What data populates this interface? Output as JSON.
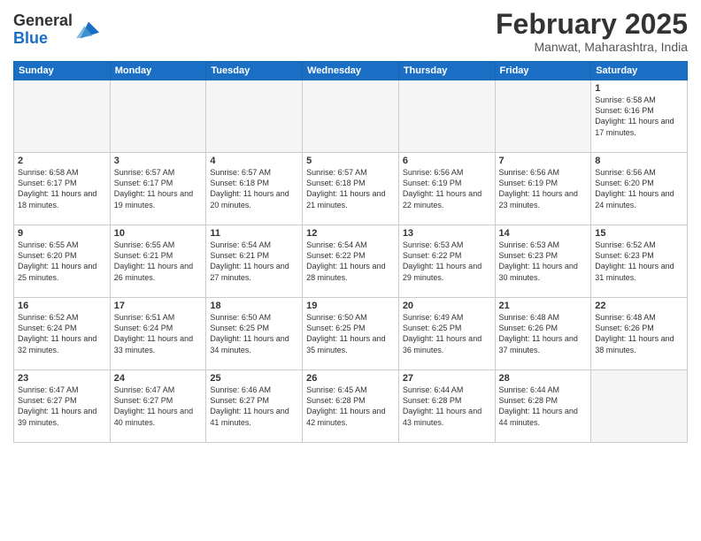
{
  "header": {
    "logo_general": "General",
    "logo_blue": "Blue",
    "title": "February 2025",
    "location": "Manwat, Maharashtra, India"
  },
  "calendar": {
    "days_of_week": [
      "Sunday",
      "Monday",
      "Tuesday",
      "Wednesday",
      "Thursday",
      "Friday",
      "Saturday"
    ],
    "weeks": [
      [
        {
          "day": "",
          "info": ""
        },
        {
          "day": "",
          "info": ""
        },
        {
          "day": "",
          "info": ""
        },
        {
          "day": "",
          "info": ""
        },
        {
          "day": "",
          "info": ""
        },
        {
          "day": "",
          "info": ""
        },
        {
          "day": "1",
          "info": "Sunrise: 6:58 AM\nSunset: 6:16 PM\nDaylight: 11 hours and 17 minutes."
        }
      ],
      [
        {
          "day": "2",
          "info": "Sunrise: 6:58 AM\nSunset: 6:17 PM\nDaylight: 11 hours and 18 minutes."
        },
        {
          "day": "3",
          "info": "Sunrise: 6:57 AM\nSunset: 6:17 PM\nDaylight: 11 hours and 19 minutes."
        },
        {
          "day": "4",
          "info": "Sunrise: 6:57 AM\nSunset: 6:18 PM\nDaylight: 11 hours and 20 minutes."
        },
        {
          "day": "5",
          "info": "Sunrise: 6:57 AM\nSunset: 6:18 PM\nDaylight: 11 hours and 21 minutes."
        },
        {
          "day": "6",
          "info": "Sunrise: 6:56 AM\nSunset: 6:19 PM\nDaylight: 11 hours and 22 minutes."
        },
        {
          "day": "7",
          "info": "Sunrise: 6:56 AM\nSunset: 6:19 PM\nDaylight: 11 hours and 23 minutes."
        },
        {
          "day": "8",
          "info": "Sunrise: 6:56 AM\nSunset: 6:20 PM\nDaylight: 11 hours and 24 minutes."
        }
      ],
      [
        {
          "day": "9",
          "info": "Sunrise: 6:55 AM\nSunset: 6:20 PM\nDaylight: 11 hours and 25 minutes."
        },
        {
          "day": "10",
          "info": "Sunrise: 6:55 AM\nSunset: 6:21 PM\nDaylight: 11 hours and 26 minutes."
        },
        {
          "day": "11",
          "info": "Sunrise: 6:54 AM\nSunset: 6:21 PM\nDaylight: 11 hours and 27 minutes."
        },
        {
          "day": "12",
          "info": "Sunrise: 6:54 AM\nSunset: 6:22 PM\nDaylight: 11 hours and 28 minutes."
        },
        {
          "day": "13",
          "info": "Sunrise: 6:53 AM\nSunset: 6:22 PM\nDaylight: 11 hours and 29 minutes."
        },
        {
          "day": "14",
          "info": "Sunrise: 6:53 AM\nSunset: 6:23 PM\nDaylight: 11 hours and 30 minutes."
        },
        {
          "day": "15",
          "info": "Sunrise: 6:52 AM\nSunset: 6:23 PM\nDaylight: 11 hours and 31 minutes."
        }
      ],
      [
        {
          "day": "16",
          "info": "Sunrise: 6:52 AM\nSunset: 6:24 PM\nDaylight: 11 hours and 32 minutes."
        },
        {
          "day": "17",
          "info": "Sunrise: 6:51 AM\nSunset: 6:24 PM\nDaylight: 11 hours and 33 minutes."
        },
        {
          "day": "18",
          "info": "Sunrise: 6:50 AM\nSunset: 6:25 PM\nDaylight: 11 hours and 34 minutes."
        },
        {
          "day": "19",
          "info": "Sunrise: 6:50 AM\nSunset: 6:25 PM\nDaylight: 11 hours and 35 minutes."
        },
        {
          "day": "20",
          "info": "Sunrise: 6:49 AM\nSunset: 6:25 PM\nDaylight: 11 hours and 36 minutes."
        },
        {
          "day": "21",
          "info": "Sunrise: 6:48 AM\nSunset: 6:26 PM\nDaylight: 11 hours and 37 minutes."
        },
        {
          "day": "22",
          "info": "Sunrise: 6:48 AM\nSunset: 6:26 PM\nDaylight: 11 hours and 38 minutes."
        }
      ],
      [
        {
          "day": "23",
          "info": "Sunrise: 6:47 AM\nSunset: 6:27 PM\nDaylight: 11 hours and 39 minutes."
        },
        {
          "day": "24",
          "info": "Sunrise: 6:47 AM\nSunset: 6:27 PM\nDaylight: 11 hours and 40 minutes."
        },
        {
          "day": "25",
          "info": "Sunrise: 6:46 AM\nSunset: 6:27 PM\nDaylight: 11 hours and 41 minutes."
        },
        {
          "day": "26",
          "info": "Sunrise: 6:45 AM\nSunset: 6:28 PM\nDaylight: 11 hours and 42 minutes."
        },
        {
          "day": "27",
          "info": "Sunrise: 6:44 AM\nSunset: 6:28 PM\nDaylight: 11 hours and 43 minutes."
        },
        {
          "day": "28",
          "info": "Sunrise: 6:44 AM\nSunset: 6:28 PM\nDaylight: 11 hours and 44 minutes."
        },
        {
          "day": "",
          "info": ""
        }
      ]
    ]
  }
}
